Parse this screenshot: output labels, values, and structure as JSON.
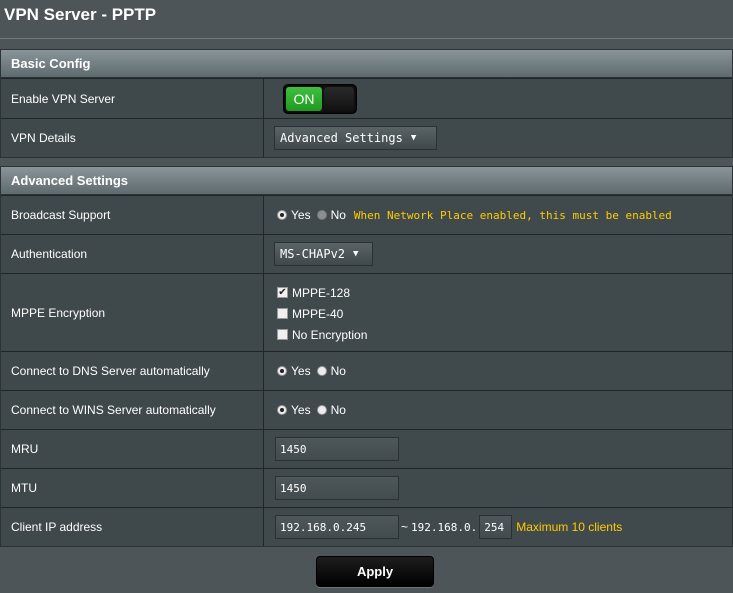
{
  "page": {
    "title": "VPN Server - PPTP"
  },
  "basic": {
    "header": "Basic Config",
    "enable_label": "Enable VPN Server",
    "toggle_state": "ON",
    "details_label": "VPN Details",
    "details_value": "Advanced Settings"
  },
  "advanced": {
    "header": "Advanced Settings",
    "broadcast": {
      "label": "Broadcast Support",
      "yes": "Yes",
      "no": "No",
      "selected": "Yes",
      "hint": "When Network Place enabled, this must be enabled"
    },
    "auth": {
      "label": "Authentication",
      "value": "MS-CHAPv2"
    },
    "mppe": {
      "label": "MPPE Encryption",
      "options": [
        {
          "label": "MPPE-128",
          "checked": true
        },
        {
          "label": "MPPE-40",
          "checked": false
        },
        {
          "label": "No Encryption",
          "checked": false
        }
      ]
    },
    "dns": {
      "label": "Connect to DNS Server automatically",
      "yes": "Yes",
      "no": "No",
      "selected": "Yes"
    },
    "wins": {
      "label": "Connect to WINS Server automatically",
      "yes": "Yes",
      "no": "No",
      "selected": "Yes"
    },
    "mru": {
      "label": "MRU",
      "value": "1450"
    },
    "mtu": {
      "label": "MTU",
      "value": "1450"
    },
    "client_ip": {
      "label": "Client IP address",
      "start": "192.168.0.245",
      "tilde": "~",
      "end_prefix": "192.168.0.",
      "end": "254",
      "hint": "Maximum 10 clients"
    }
  },
  "apply_label": "Apply",
  "colors": {
    "accent_green": "#2faf2f",
    "hint_yellow": "#ffcc00",
    "background": "#4d5558"
  }
}
